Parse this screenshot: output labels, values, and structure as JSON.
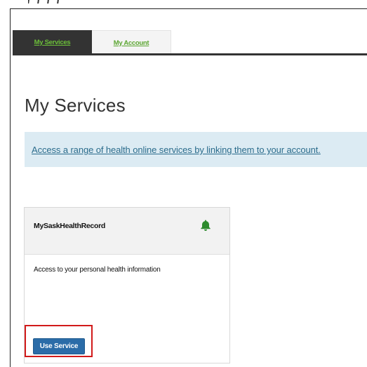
{
  "nav": {
    "tabs": [
      {
        "label": "My Services",
        "active": true
      },
      {
        "label": "My Account",
        "active": false
      }
    ]
  },
  "main": {
    "title": "My Services",
    "banner_link": "Access a range of health online services by linking them to your account."
  },
  "service_card": {
    "title": "MySaskHealthRecord",
    "description": "Access to your personal health information",
    "button_label": "Use Service",
    "icon": "bell-icon"
  },
  "colors": {
    "tab_active_bg": "#333333",
    "tab_text_green": "#6cbf3a",
    "banner_bg": "#dcebf3",
    "link_blue": "#2b6c8c",
    "button_blue": "#2b6ca8",
    "bell_green": "#2e8b2e",
    "highlight_red": "#d11a1a"
  }
}
